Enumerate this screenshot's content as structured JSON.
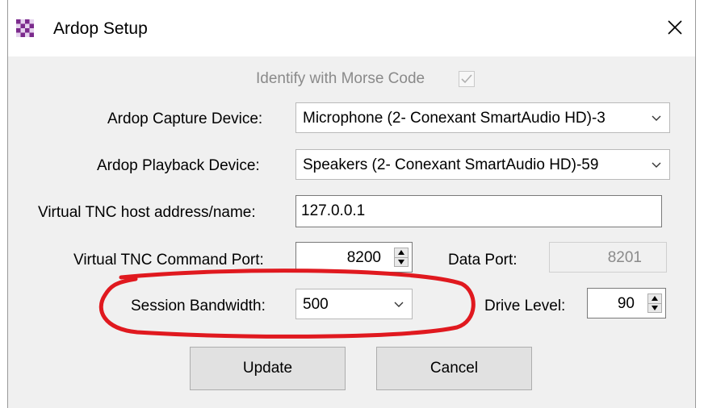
{
  "window": {
    "title": "Ardop Setup",
    "icon": "checkered-app-icon",
    "close_icon": "close-icon"
  },
  "morse": {
    "label": "Identify with Morse Code",
    "checked": true
  },
  "capture": {
    "label": "Ardop Capture Device:",
    "value": "Microphone (2- Conexant SmartAudio HD)-3"
  },
  "playback": {
    "label": "Ardop Playback Device:",
    "value": "Speakers (2- Conexant SmartAudio HD)-59"
  },
  "host": {
    "label": "Virtual TNC host address/name:",
    "value": "127.0.0.1"
  },
  "command_port": {
    "label": "Virtual TNC Command Port:",
    "value": "8200"
  },
  "data_port": {
    "label": "Data Port:",
    "value": "8201"
  },
  "bandwidth": {
    "label": "Session Bandwidth:",
    "value": "500"
  },
  "drive": {
    "label": "Drive Level:",
    "value": "90"
  },
  "buttons": {
    "update": "Update",
    "cancel": "Cancel"
  },
  "colors": {
    "highlight_ring": "#e0191f",
    "window_bg": "#f0f0f0"
  }
}
